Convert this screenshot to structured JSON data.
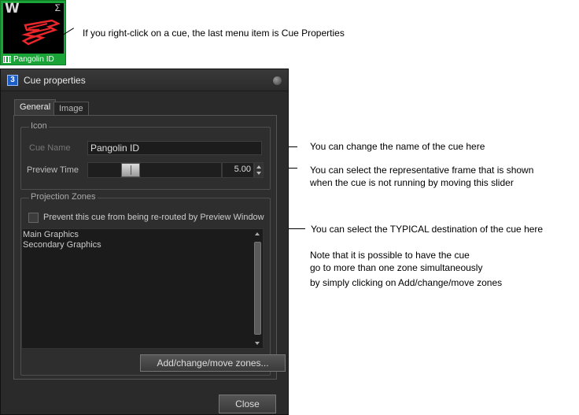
{
  "cue_thumbnail": {
    "letter": "W",
    "sigma": "Σ",
    "caption": "Pangolin ID"
  },
  "notes": {
    "right_click": "If you right-click on a cue, the last menu item is Cue Properties",
    "name": "You can change the name of the cue here",
    "frame_line1": "You can select the representative frame that is shown",
    "frame_line2": "when the cue is not running by moving this slider",
    "destination": "You can select the TYPICAL destination of the cue here",
    "multi_line1": "Note that it is possible to have the cue",
    "multi_line2": "go to more than one zone simultaneously",
    "multi_line3": "by simply clicking on Add/change/move zones"
  },
  "dialog": {
    "title": "Cue properties",
    "tabs": [
      "General",
      "Image"
    ],
    "icon_group": {
      "title": "Icon",
      "cue_name_label": "Cue Name",
      "cue_name_value": "Pangolin ID",
      "preview_time_label": "Preview Time",
      "preview_time_value": "5.00",
      "slider_position_fraction": 0.29
    },
    "zones_group": {
      "title": "Projection Zones",
      "reroute_label": "Prevent this cue from being re-routed by Preview Window",
      "zones": [
        "Main Graphics",
        "Secondary Graphics"
      ],
      "add_button": "Add/change/move zones..."
    },
    "close_button": "Close"
  },
  "colors": {
    "thumbnail_border": "#1aa437",
    "dialog_background": "#2a2a2a",
    "cue_art": "#e8262b"
  }
}
